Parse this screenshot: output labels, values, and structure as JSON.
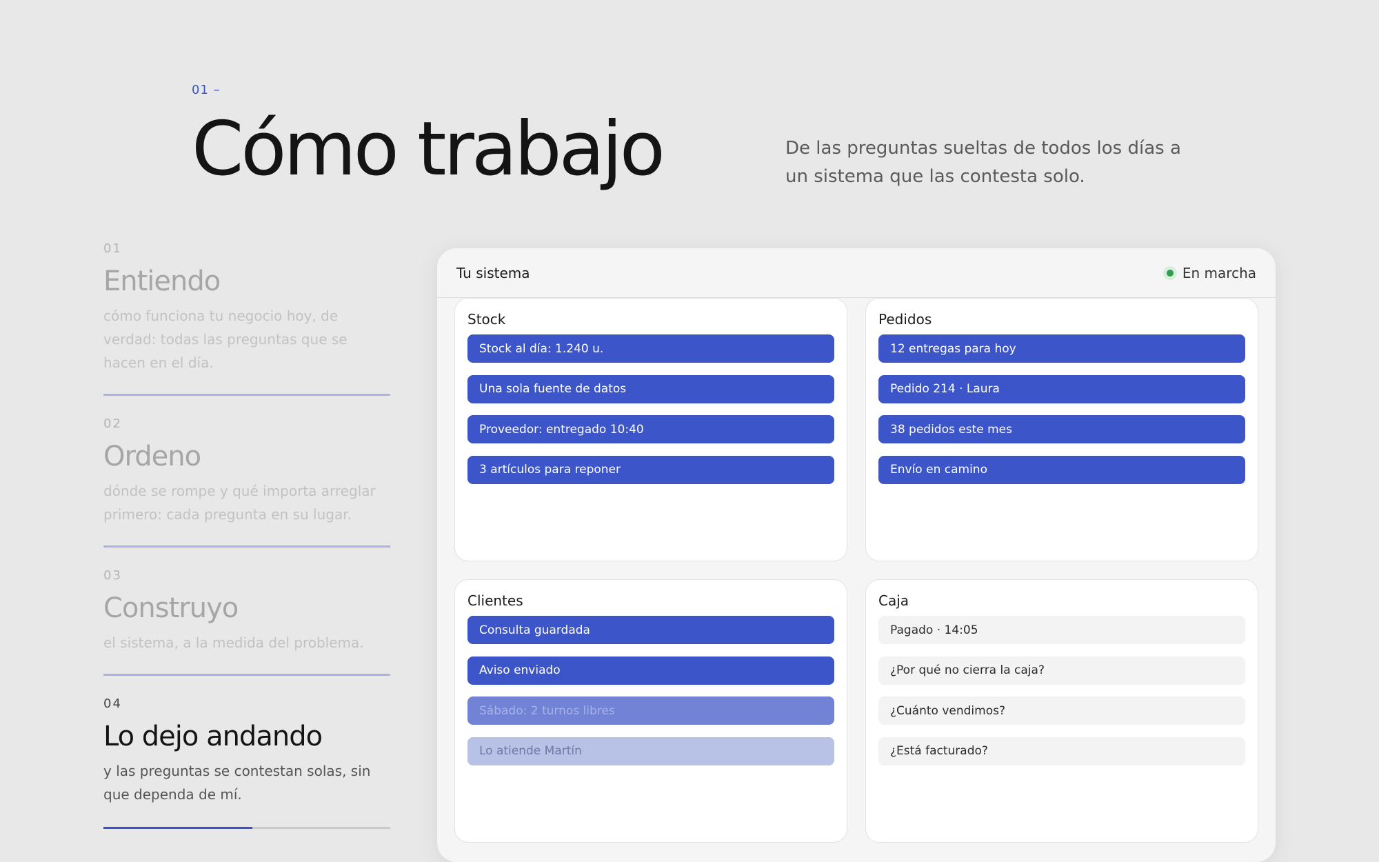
{
  "header": {
    "eyebrow": "01 –",
    "title": "Cómo trabajo",
    "intro": "De las preguntas sueltas de todos los días a un sistema que las contesta solo."
  },
  "steps": [
    {
      "num": "01",
      "title": "Entiendo",
      "desc": "cómo funciona tu negocio hoy, de verdad: todas las preguntas que se hacen en el día."
    },
    {
      "num": "02",
      "title": "Ordeno",
      "desc": "dónde se rompe y qué importa arreglar primero: cada pregunta en su lugar."
    },
    {
      "num": "03",
      "title": "Construyo",
      "desc": "el sistema, a la medida del problema."
    },
    {
      "num": "04",
      "title": "Lo dejo andando",
      "desc": "y las preguntas se contestan solas, sin que dependa de mí.",
      "progress": 0.52
    }
  ],
  "panel": {
    "title": "Tu sistema",
    "status": "En marcha",
    "status_color": "#2f9e4f",
    "accent": "#3c55c8",
    "cards": [
      {
        "title": "Stock",
        "items": [
          "Stock al día: 1.240 u.",
          "Una sola fuente de datos",
          "Proveedor: entregado 10:40",
          "3 artículos para reponer"
        ]
      },
      {
        "title": "Pedidos",
        "items": [
          "12 entregas para hoy",
          "Pedido 214 · Laura",
          "38 pedidos este mes",
          "Envío en camino"
        ]
      },
      {
        "title": "Clientes",
        "items": [
          "Consulta guardada",
          "Aviso enviado",
          "Sábado: 2 turnos libres",
          "Lo atiende Martín"
        ]
      },
      {
        "title": "Caja",
        "items": [
          "Pagado · 14:05",
          "¿Por qué no cierra la caja?",
          "¿Cuánto vendimos?",
          "¿Está facturado?"
        ]
      }
    ]
  }
}
